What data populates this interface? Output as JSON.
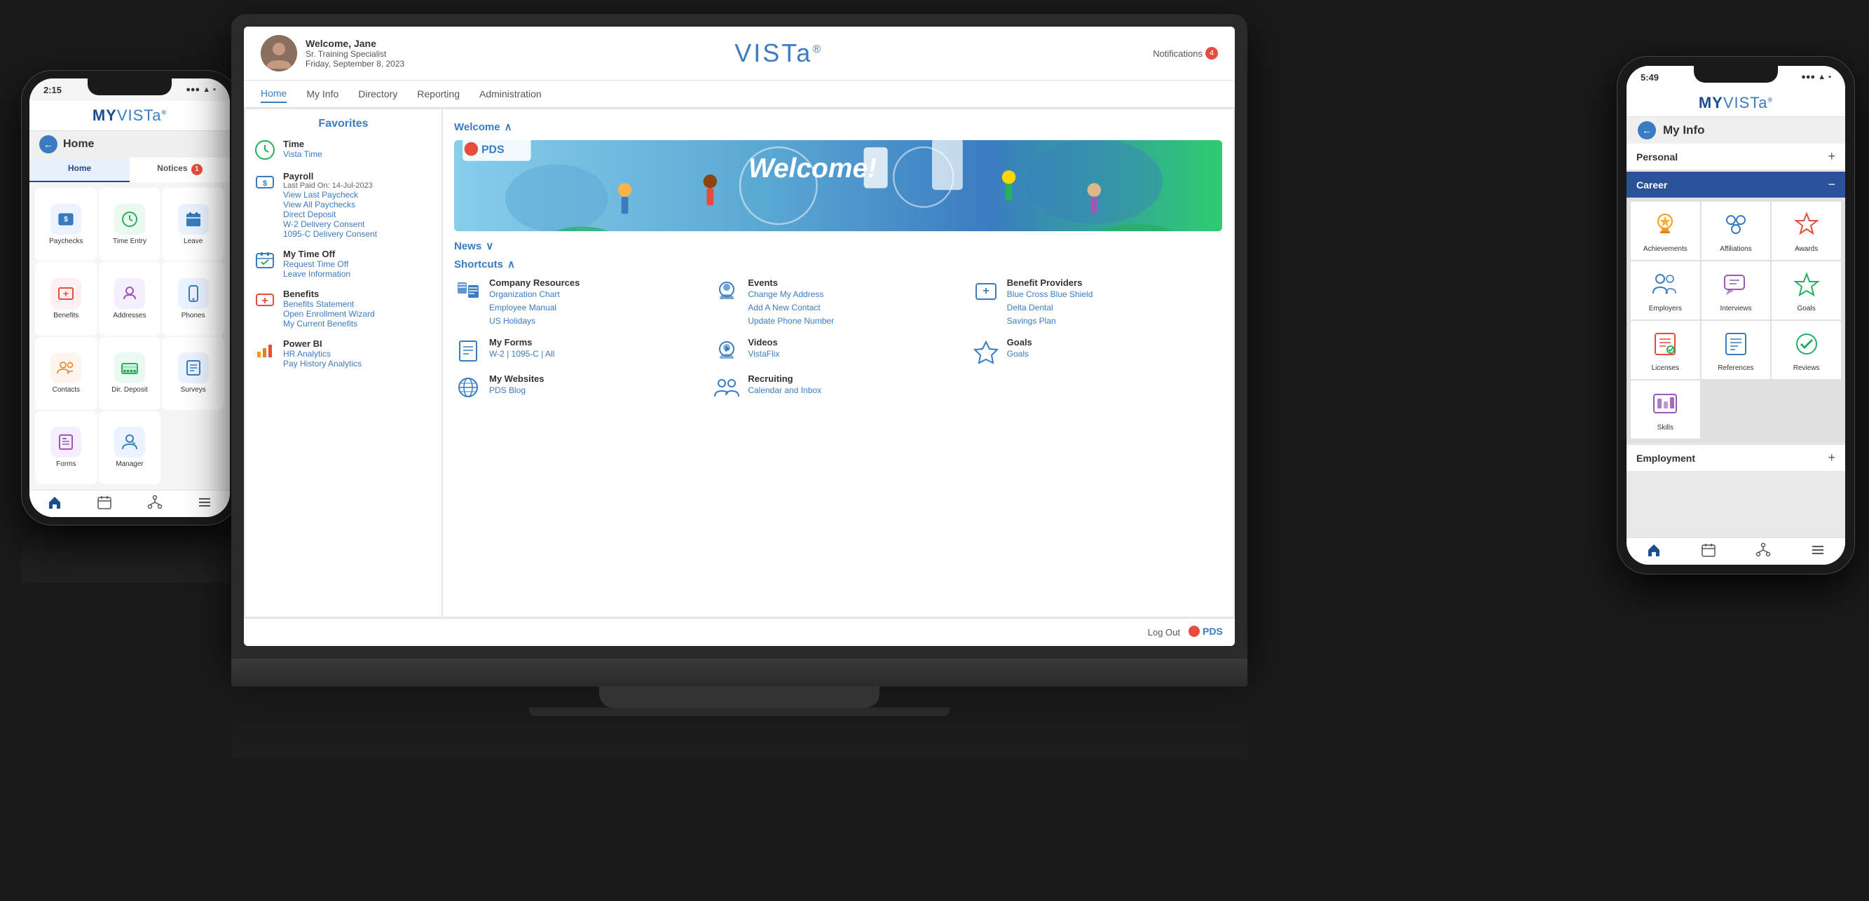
{
  "laptop": {
    "header": {
      "user_name": "Welcome, Jane",
      "user_role": "Sr. Training Specialist",
      "user_date": "Friday, September 8, 2023",
      "logo": "VISTa",
      "notifications_label": "Notifications",
      "notifications_count": "4"
    },
    "nav": {
      "items": [
        "Home",
        "My Info",
        "Directory",
        "Reporting",
        "Administration"
      ],
      "active": "Home"
    },
    "sidebar": {
      "title": "Favorites",
      "items": [
        {
          "title": "Time",
          "link1": "Vista Time",
          "icon": "⏰"
        },
        {
          "title": "Payroll",
          "subtitle": "Last Paid On: 14-Jul-2023",
          "links": [
            "View Last Paycheck",
            "View All Paychecks",
            "Direct Deposit",
            "W-2 Delivery Consent",
            "1095-C Delivery Consent"
          ],
          "icon": "💲"
        },
        {
          "title": "My Time Off",
          "links": [
            "Request Time Off",
            "Leave Information"
          ],
          "icon": "☑"
        },
        {
          "title": "Benefits",
          "links": [
            "Benefits Statement",
            "Open Enrollment Wizard",
            "My Current Benefits"
          ],
          "icon": "➕"
        },
        {
          "title": "Power BI",
          "links": [
            "HR Analytics",
            "Pay History Analytics"
          ],
          "icon": "📊"
        }
      ]
    },
    "welcome": {
      "section_label": "Welcome",
      "banner_pds": "●PDS",
      "banner_text": "Welcome!"
    },
    "news": {
      "section_label": "News"
    },
    "shortcuts": {
      "section_label": "Shortcuts",
      "items": [
        {
          "title": "Company Resources",
          "links": [
            "Organization Chart",
            "Employee Manual",
            "US Holidays"
          ],
          "icon": "🗂"
        },
        {
          "title": "Events",
          "links": [
            "Change My Address",
            "Add A New Contact",
            "Update Phone Number"
          ],
          "icon": "👤"
        },
        {
          "title": "Benefit Providers",
          "links": [
            "Blue Cross Blue Shield",
            "Delta Dental",
            "Savings Plan"
          ],
          "icon": "🏥"
        },
        {
          "title": "My Forms",
          "links": [
            "W-2 | 1095-C | All"
          ],
          "icon": "📋"
        },
        {
          "title": "Videos",
          "links": [
            "VistaFlix"
          ],
          "icon": "🎬"
        },
        {
          "title": "Goals",
          "links": [
            "Goals"
          ],
          "icon": "🏆"
        },
        {
          "title": "My Websites",
          "links": [
            "PDS Blog"
          ],
          "icon": "🌐"
        },
        {
          "title": "Recruiting",
          "links": [
            "Calendar and Inbox"
          ],
          "icon": "👥"
        }
      ]
    },
    "footer": {
      "logout_label": "Log Out",
      "pds_logo": "●PDS"
    }
  },
  "phone_left": {
    "time": "2:15",
    "status": "●●● ▲ WiFi Batt",
    "logo_my": "MY",
    "logo_vista": "VISTa",
    "nav_title": "Home",
    "tabs": [
      {
        "label": "Home",
        "active": true
      },
      {
        "label": "Notices",
        "badge": "1",
        "active": false
      }
    ],
    "apps": [
      {
        "label": "Paychecks",
        "icon": "💲",
        "color": "#3a7cc1"
      },
      {
        "label": "Time Entry",
        "icon": "⏰",
        "color": "#27ae60"
      },
      {
        "label": "Leave",
        "icon": "📅",
        "color": "#3a7cc1"
      },
      {
        "label": "Benefits",
        "icon": "➕",
        "color": "#e74c3c"
      },
      {
        "label": "Addresses",
        "icon": "👤",
        "color": "#9b59b6"
      },
      {
        "label": "Phones",
        "icon": "📱",
        "color": "#3a7cc1"
      },
      {
        "label": "Contacts",
        "icon": "👥",
        "color": "#e67e22"
      },
      {
        "label": "Dir. Deposit",
        "icon": "🏦",
        "color": "#27ae60"
      },
      {
        "label": "Surveys",
        "icon": "📋",
        "color": "#3a7cc1"
      },
      {
        "label": "Forms",
        "icon": "📄",
        "color": "#9b59b6"
      },
      {
        "label": "Manager",
        "icon": "👔",
        "color": "#3a7cc1"
      }
    ],
    "bottom_nav": [
      "🏠",
      "⏰",
      "⚙",
      "☰"
    ]
  },
  "phone_right": {
    "time": "5:49",
    "logo_my": "MY",
    "logo_vista": "VISTa",
    "nav_title": "My Info",
    "sections": {
      "personal": "Personal",
      "career": "Career",
      "employment": "Employment"
    },
    "career_items": [
      {
        "label": "Achievements",
        "icon": "🏅",
        "color": "#f39c12"
      },
      {
        "label": "Affiliations",
        "icon": "🔗",
        "color": "#3a7cc1"
      },
      {
        "label": "Awards",
        "icon": "🏆",
        "color": "#e74c3c"
      },
      {
        "label": "Employers",
        "icon": "👥",
        "color": "#3a7cc1"
      },
      {
        "label": "Interviews",
        "icon": "💬",
        "color": "#9b59b6"
      },
      {
        "label": "Goals",
        "icon": "🎯",
        "color": "#27ae60"
      },
      {
        "label": "Licenses",
        "icon": "📜",
        "color": "#e74c3c"
      },
      {
        "label": "References",
        "icon": "📋",
        "color": "#3a7cc1"
      },
      {
        "label": "Reviews",
        "icon": "✅",
        "color": "#27ae60"
      },
      {
        "label": "Skills",
        "icon": "⚡",
        "color": "#9b59b6"
      }
    ],
    "bottom_nav": [
      "🏠",
      "⏰",
      "⚙",
      "☰"
    ]
  }
}
